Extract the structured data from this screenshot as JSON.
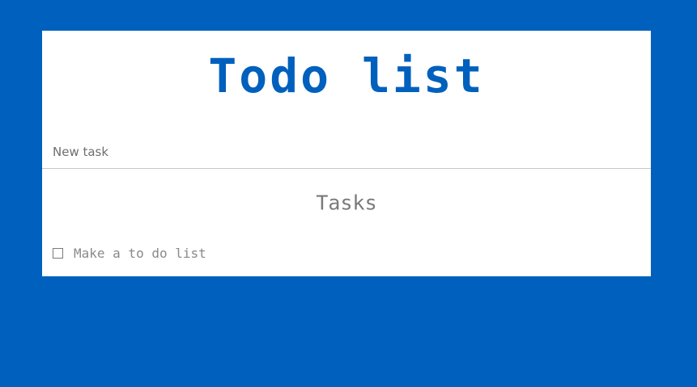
{
  "app": {
    "title": "Todo list"
  },
  "new_task": {
    "placeholder": "New task",
    "value": ""
  },
  "tasks": {
    "heading": "Tasks",
    "items": [
      {
        "label": "Make a to do list",
        "checked": false
      }
    ]
  },
  "colors": {
    "background": "#0060bd",
    "card": "#ffffff",
    "title": "#0060bd",
    "muted_text": "#7a7a7a"
  }
}
